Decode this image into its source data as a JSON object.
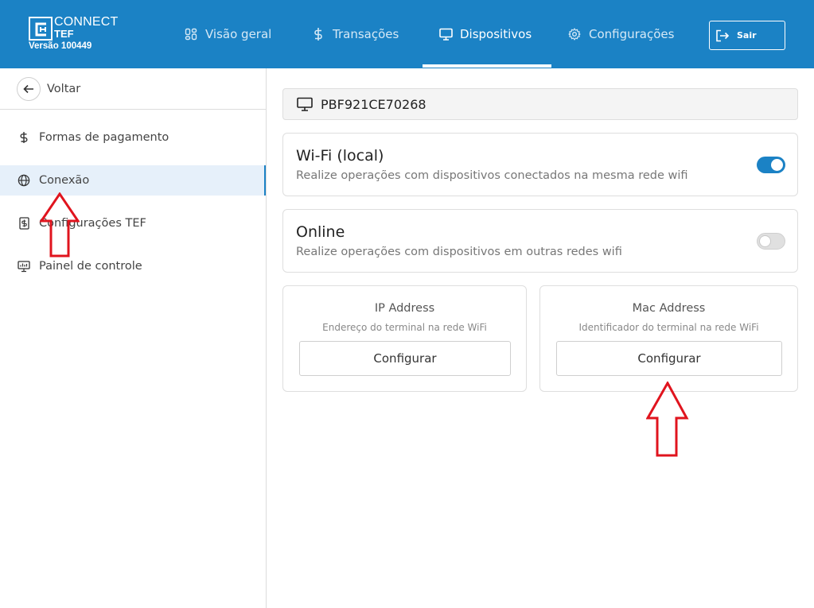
{
  "header": {
    "logo_connect": "CONNECT",
    "logo_tef": "TEF",
    "version": "Versão 100449",
    "nav": [
      {
        "label": "Visão geral",
        "icon": "dashboard-icon"
      },
      {
        "label": "Transações",
        "icon": "dollar-icon"
      },
      {
        "label": "Dispositivos",
        "icon": "monitor-icon",
        "active": true
      },
      {
        "label": "Configurações",
        "icon": "gear-icon"
      }
    ],
    "logout_label": "Sair"
  },
  "sidebar": {
    "back_label": "Voltar",
    "items": [
      {
        "label": "Formas de pagamento",
        "icon": "dollar-icon"
      },
      {
        "label": "Conexão",
        "icon": "globe-icon",
        "active": true
      },
      {
        "label": "Configurações TEF",
        "icon": "receipt-icon"
      },
      {
        "label": "Painel de controle",
        "icon": "control-panel-icon"
      }
    ]
  },
  "main": {
    "device_id": "PBF921CE70268",
    "connections": [
      {
        "title": "Wi-Fi (local)",
        "subtitle": "Realize operações com dispositivos conectados na mesma rede wifi",
        "enabled": true
      },
      {
        "title": "Online",
        "subtitle": "Realize operações com dispositivos em outras redes wifi",
        "enabled": false
      }
    ],
    "ip": {
      "title": "IP Address",
      "subtitle": "Endereço do terminal na rede WiFi",
      "button": "Configurar"
    },
    "mac": {
      "title": "Mac Address",
      "subtitle": "Identificador do terminal na rede WiFi",
      "button": "Configurar"
    }
  },
  "colors": {
    "brand": "#1b82c5",
    "annotation": "#e0141e"
  }
}
